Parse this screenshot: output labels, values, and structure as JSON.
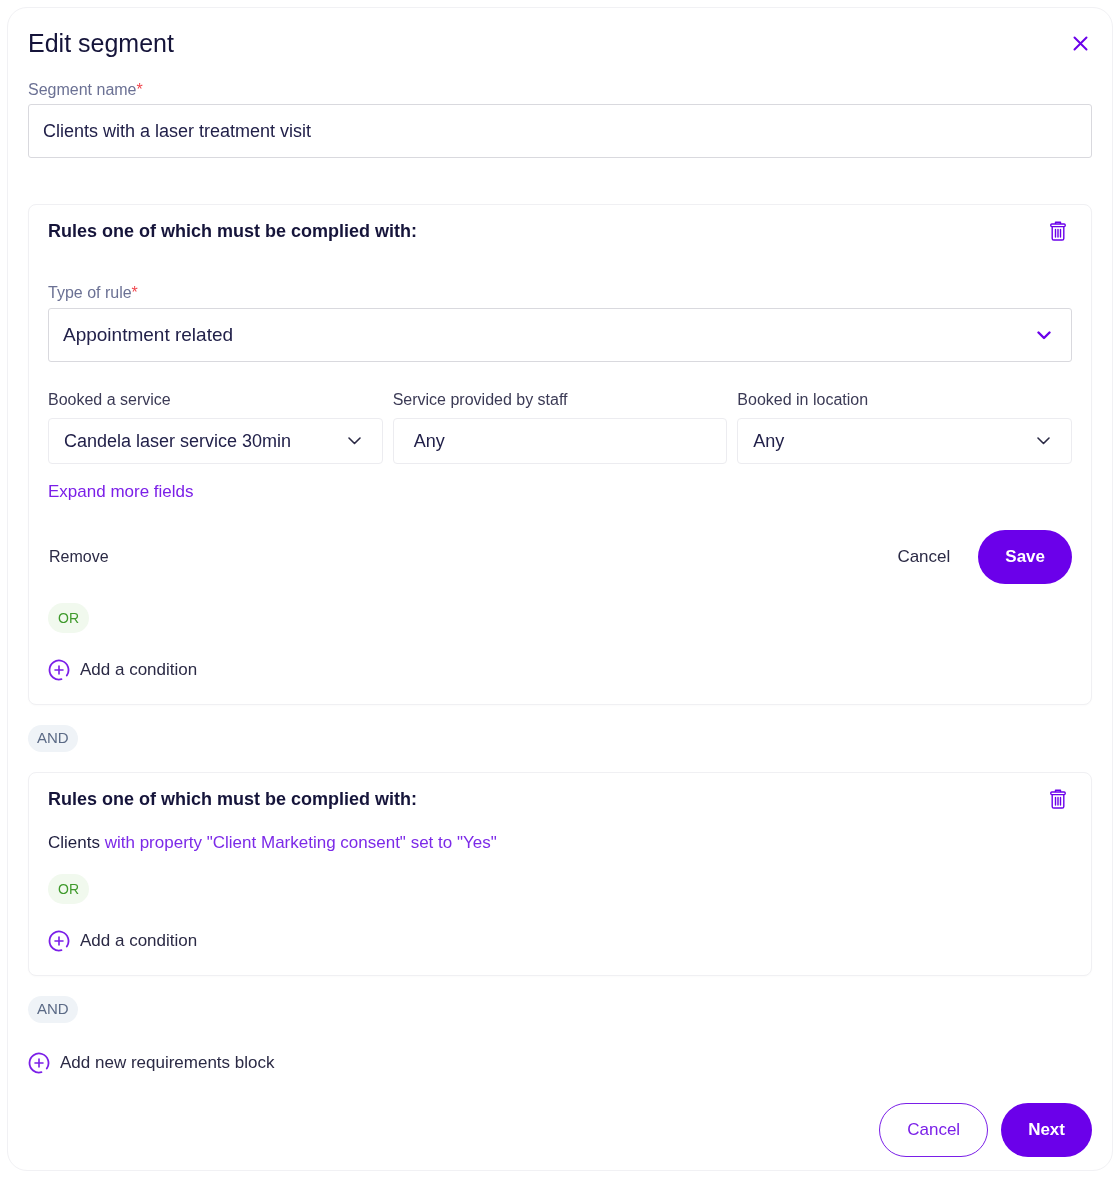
{
  "dialog": {
    "title": "Edit segment"
  },
  "segment_name": {
    "label": "Segment name",
    "required_mark": "*",
    "value": "Clients with a laser treatment visit"
  },
  "blocks": [
    {
      "title": "Rules one of which must be complied with:",
      "condition": {
        "kind": "editor",
        "rule_type": {
          "label": "Type of rule",
          "required_mark": "*",
          "value": "Appointment related"
        },
        "fields": [
          {
            "kind": "select",
            "label": "Booked a service",
            "value": "Candela laser service 30min"
          },
          {
            "kind": "input",
            "label": "Service provided by staff",
            "value": "Any"
          },
          {
            "kind": "select",
            "label": "Booked in location",
            "value": "Any"
          }
        ],
        "expand_link": "Expand more fields",
        "remove_link": "Remove",
        "buttons": [
          {
            "kind": "text",
            "label": "Cancel"
          },
          {
            "kind": "primary",
            "label": "Save"
          }
        ]
      },
      "or_label": "OR",
      "add_condition": "Add a condition",
      "and_label": "AND"
    },
    {
      "title": "Rules one of which must be complied with:",
      "condition": {
        "kind": "summary",
        "subject": "Clients",
        "detail": "with property \"Client Marketing consent\" set to \"Yes\""
      },
      "or_label": "OR",
      "add_condition": "Add a condition",
      "and_label": "AND"
    }
  ],
  "add_block": "Add new requirements block",
  "footer": {
    "buttons": [
      {
        "kind": "outline",
        "label": "Cancel"
      },
      {
        "kind": "primary",
        "label": "Next"
      }
    ]
  }
}
